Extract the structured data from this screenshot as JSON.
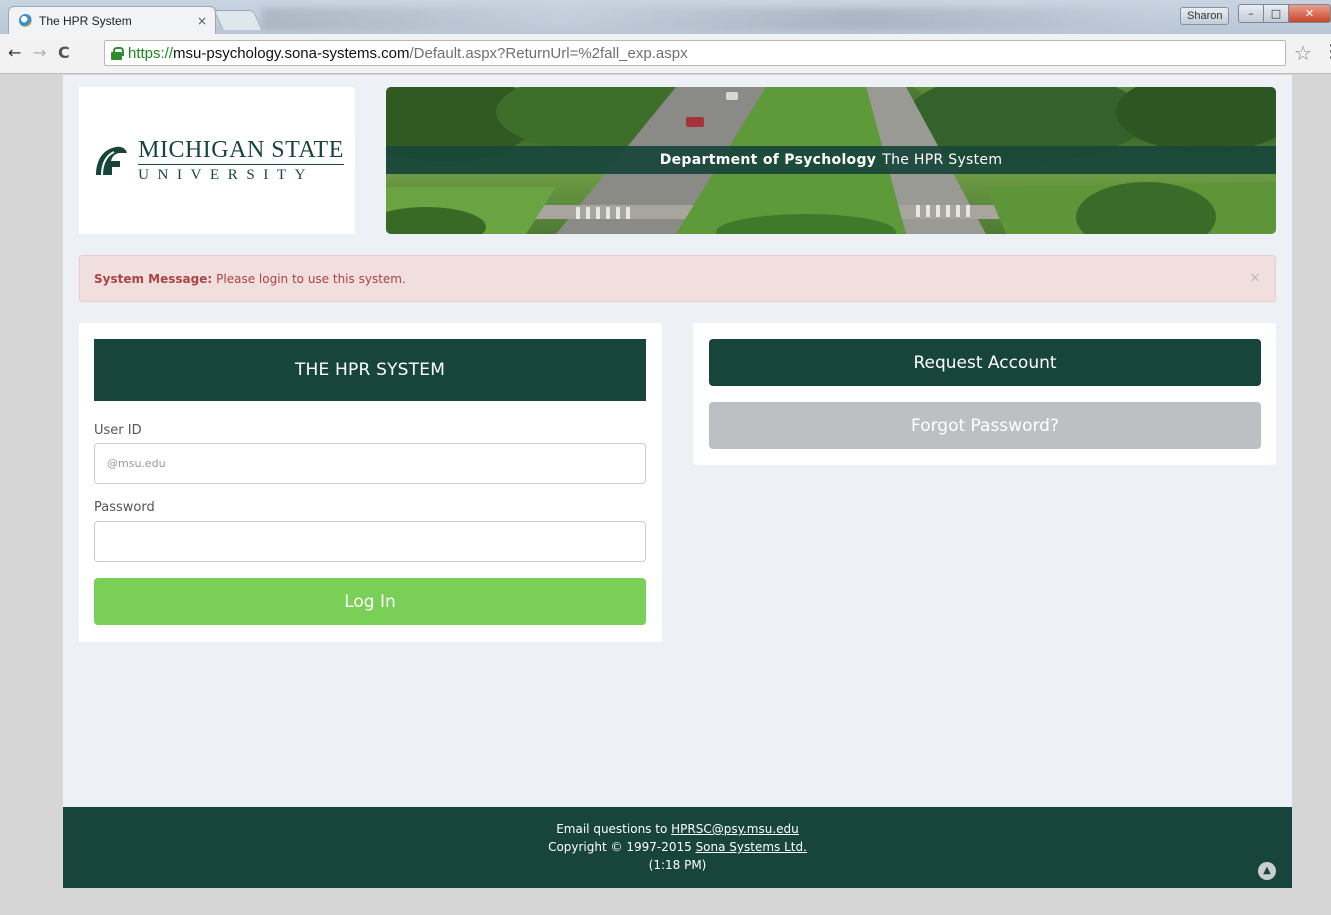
{
  "browser": {
    "tab_title": "The HPR System",
    "tab_close": "×",
    "profile_name": "Sharon",
    "url_scheme": "https://",
    "url_host": "msu-psychology.sona-systems.com",
    "url_path": "/Default.aspx?ReturnUrl=%2fall_exp.aspx",
    "icons": [
      "back-icon",
      "forward-icon",
      "reload-icon",
      "lock-icon",
      "star-icon",
      "menu-icon"
    ]
  },
  "header": {
    "logo_line1": "MICHIGAN STATE",
    "logo_line2": "UNIVERSITY",
    "banner_bold": "Department of Psychology",
    "banner_text": "The HPR System"
  },
  "alert": {
    "label": "System Message:",
    "text": "Please login to use this system.",
    "close": "×"
  },
  "login": {
    "title": "THE HPR SYSTEM",
    "user_label": "User ID",
    "user_placeholder": "@msu.edu",
    "user_value": "",
    "password_label": "Password",
    "password_value": "",
    "button": "Log In"
  },
  "side": {
    "request_button": "Request Account",
    "forgot_button": "Forgot Password?"
  },
  "footer": {
    "line1_prefix": "Email questions to",
    "email": "HPRSC@psy.msu.edu",
    "line2_prefix": "Copyright © 1997-2015",
    "company": "Sona Systems Ltd.",
    "time": "(1:18 PM)"
  },
  "colors": {
    "msu_green": "#18453b",
    "login_green": "#7ad057",
    "alert_bg": "#f1dede",
    "alert_text": "#a94442",
    "disabled_gray": "#bcc0c3"
  }
}
